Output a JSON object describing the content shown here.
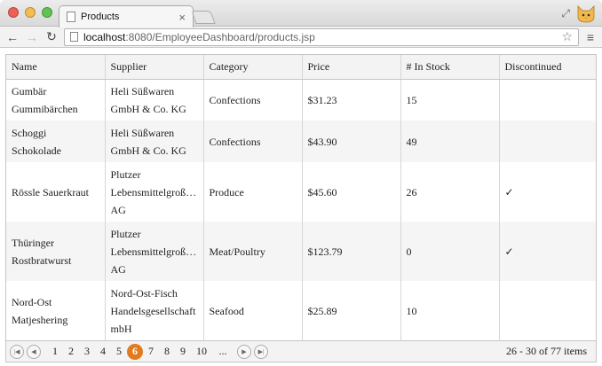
{
  "browser": {
    "tab_title": "Products",
    "tab_close": "×",
    "url_host": "localhost",
    "url_rest": ":8080/EmployeeDashboard/products.jsp",
    "colors": {
      "close": "#ee5f57",
      "minimize": "#f5bd4f",
      "maximize": "#5fc453"
    }
  },
  "grid": {
    "columns": [
      "Name",
      "Supplier",
      "Category",
      "Price",
      "# In Stock",
      "Discontinued"
    ],
    "rows": [
      {
        "name": [
          "Gumbär",
          "Gummibärchen"
        ],
        "supplier": [
          "Heli Süßwaren",
          "GmbH & Co. KG"
        ],
        "category": "Confections",
        "price": "$31.23",
        "stock": "15",
        "discontinued": ""
      },
      {
        "name": [
          "Schoggi",
          "Schokolade"
        ],
        "supplier": [
          "Heli Süßwaren",
          "GmbH & Co. KG"
        ],
        "category": "Confections",
        "price": "$43.90",
        "stock": "49",
        "discontinued": ""
      },
      {
        "name": [
          "Rössle Sauerkraut"
        ],
        "supplier": [
          "Plutzer",
          "Lebensmittelgroß…",
          "AG"
        ],
        "category": "Produce",
        "price": "$45.60",
        "stock": "26",
        "discontinued": "✓"
      },
      {
        "name": [
          "Thüringer",
          "Rostbratwurst"
        ],
        "supplier": [
          "Plutzer",
          "Lebensmittelgroß…",
          "AG"
        ],
        "category": "Meat/Poultry",
        "price": "$123.79",
        "stock": "0",
        "discontinued": "✓"
      },
      {
        "name": [
          "Nord-Ost",
          "Matjeshering"
        ],
        "supplier": [
          "Nord-Ost-Fisch",
          "Handelsgesellschaft",
          "mbH"
        ],
        "category": "Seafood",
        "price": "$25.89",
        "stock": "10",
        "discontinued": ""
      }
    ]
  },
  "pager": {
    "pages": [
      "1",
      "2",
      "3",
      "4",
      "5",
      "6",
      "7",
      "8",
      "9",
      "10",
      "..."
    ],
    "current": "6",
    "info": "26 - 30 of 77 items",
    "accent": "#e27a1e"
  }
}
